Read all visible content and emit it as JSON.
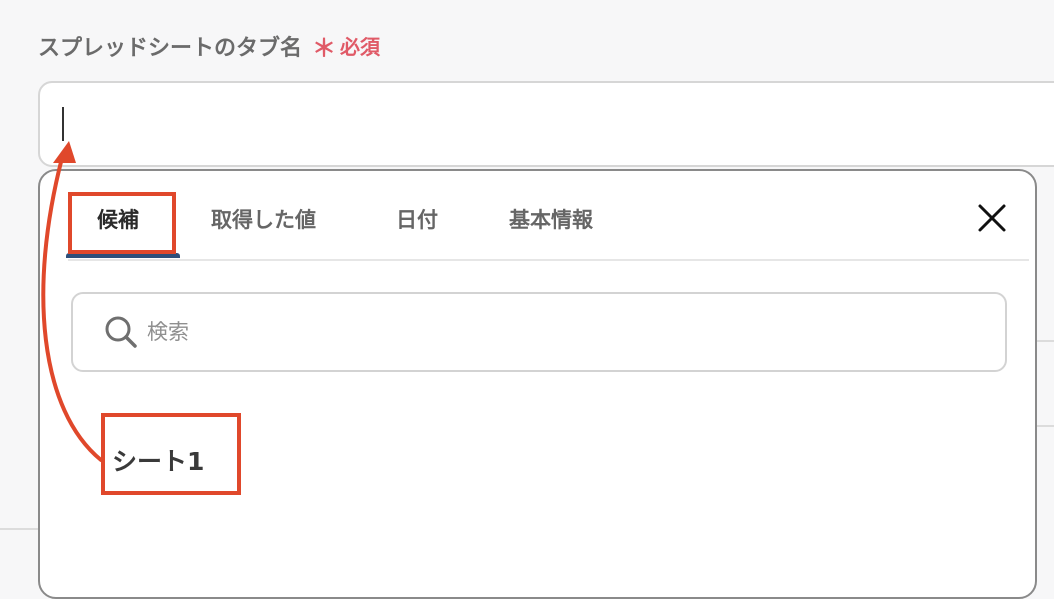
{
  "field": {
    "label": "スプレッドシートのタブ名",
    "required_mark": "＊",
    "required_text": "必須",
    "value": ""
  },
  "popup": {
    "tabs": [
      {
        "label": "候補",
        "active": true
      },
      {
        "label": "取得した値",
        "active": false
      },
      {
        "label": "日付",
        "active": false
      },
      {
        "label": "基本情報",
        "active": false
      }
    ],
    "close_icon": "close-x-icon",
    "search": {
      "placeholder": "検索",
      "icon": "search-icon"
    },
    "candidates": [
      "シート1"
    ]
  },
  "colors": {
    "required": "#e05a67",
    "annotation": "#e0482b",
    "tab_underline": "#2e4f7a"
  }
}
